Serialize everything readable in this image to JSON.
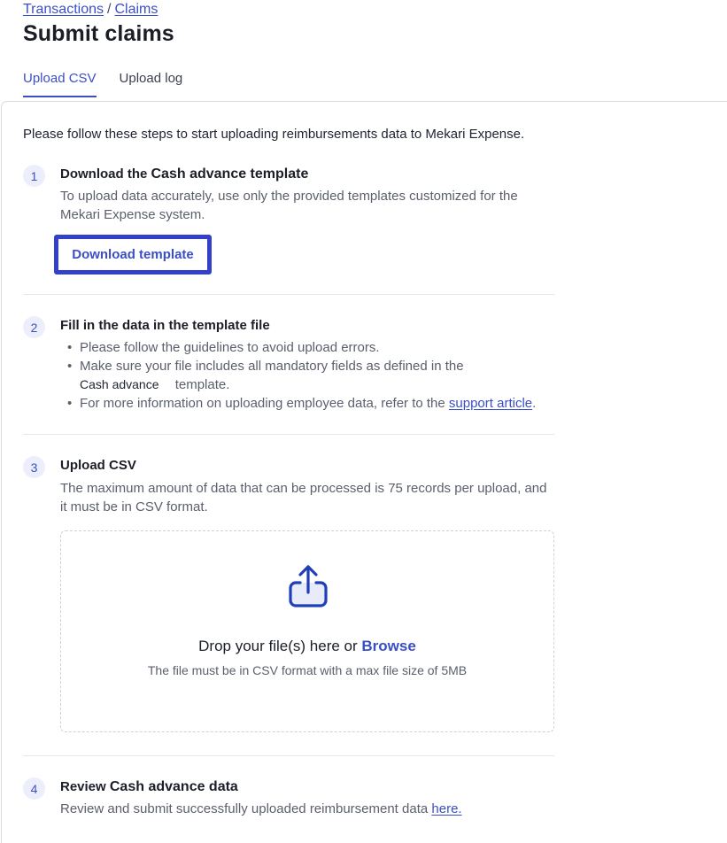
{
  "breadcrumb": {
    "items": [
      "Transactions",
      "Claims"
    ],
    "separator": "/"
  },
  "page": {
    "title": "Submit claims"
  },
  "tabs": [
    {
      "label": "Upload CSV",
      "active": true
    },
    {
      "label": "Upload log",
      "active": false
    }
  ],
  "intro": "Please follow these steps to start uploading reimbursements data to Mekari Expense.",
  "steps": {
    "step1": {
      "number": "1",
      "title_prefix": "Download the",
      "title_strong": "Cash advance template",
      "description": "To upload data accurately, use only the provided templates customized for the Mekari Expense system.",
      "button_label": "Download template"
    },
    "step2": {
      "number": "2",
      "title": "Fill in the data in the template file",
      "bullet1": "Please follow the guidelines to avoid upload errors.",
      "bullet2_prefix": "Make sure your file includes all mandatory fields as defined in the",
      "bullet2_template": "Cash advance",
      "bullet2_suffix": "template.",
      "bullet3_prefix": "For more information on uploading employee data, refer to the",
      "bullet3_link": "support article",
      "bullet3_suffix": "."
    },
    "step3": {
      "number": "3",
      "title": "Upload CSV",
      "description": "The maximum amount of data that can be processed is 75 records per upload, and it must be in CSV format.",
      "dropzone": {
        "icon": "upload-share-icon",
        "prompt": "Drop your file(s) here or",
        "browse_label": "Browse",
        "hint": "The file must be in CSV format with a max file size of 5MB"
      }
    },
    "step4": {
      "number": "4",
      "title_prefix": "Review",
      "title_strong": "Cash advance data",
      "description": "Review and submit successfully uploaded reimbursement data",
      "link_label": "here."
    }
  },
  "colors": {
    "accent": "#3b4fc4",
    "highlight_border": "#3340c9",
    "step_badge_bg": "#eceffb",
    "text_muted": "#5a5f6b"
  }
}
